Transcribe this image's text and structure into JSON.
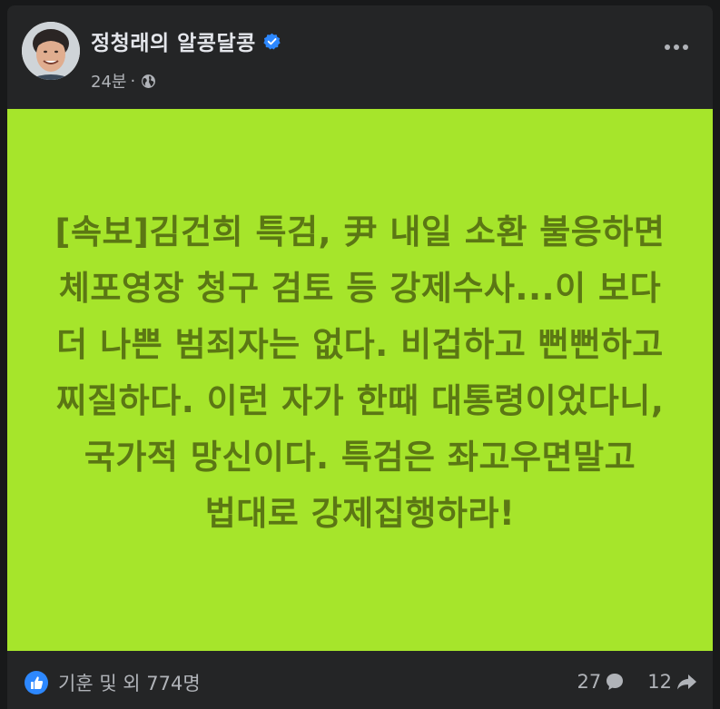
{
  "post": {
    "author": "정청래의 알콩달콩",
    "time": "24분",
    "separator": "·",
    "body_text": "[속보]김건희 특검, 尹 내일 소환 불응하면 체포영장 청구 검토 등 강제수사...이 보다 더 나쁜 범죄자는 없다. 비겁하고 뻔뻔하고 찌질하다. 이런 자가 한때 대통령이었다니, 국가적 망신이다. 특검은 좌고우면말고 법대로 강제집행하라!",
    "background_color": "#a6e52b",
    "text_color": "#5b7714"
  },
  "footer": {
    "reactions_label": "기훈 및 외 774명",
    "comments_count": "27",
    "shares_count": "12"
  },
  "icons": {
    "verified": "verified-badge-icon",
    "privacy": "globe-icon",
    "more": "more-options-icon",
    "reaction": "like-icon",
    "comment": "comment-icon",
    "share": "share-icon"
  }
}
